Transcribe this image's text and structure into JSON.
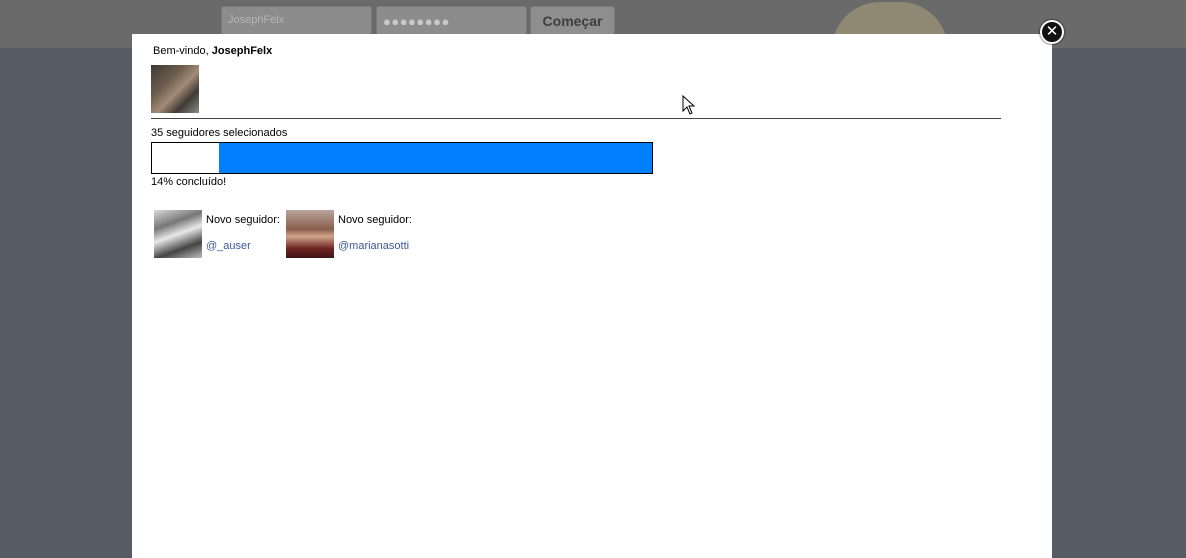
{
  "background": {
    "username_field": "JosephFelx",
    "password_field": "●●●●●●●●",
    "start_button": "Começar"
  },
  "modal": {
    "welcome_prefix": "Bem-vindo, ",
    "username": "JosephFelx",
    "selected_text": "35 seguidores selecionados",
    "progress_percent": 14,
    "progress_text": "14% concluído!",
    "close_icon": "close-icon",
    "followers": [
      {
        "label": "Novo seguidor:",
        "handle": "@_auser"
      },
      {
        "label": "Novo seguidor:",
        "handle": "@marianasotti"
      }
    ]
  },
  "colors": {
    "progress_bar": "#0080ff",
    "handle_link": "#3b5998",
    "overlay": "#5b5d61"
  }
}
